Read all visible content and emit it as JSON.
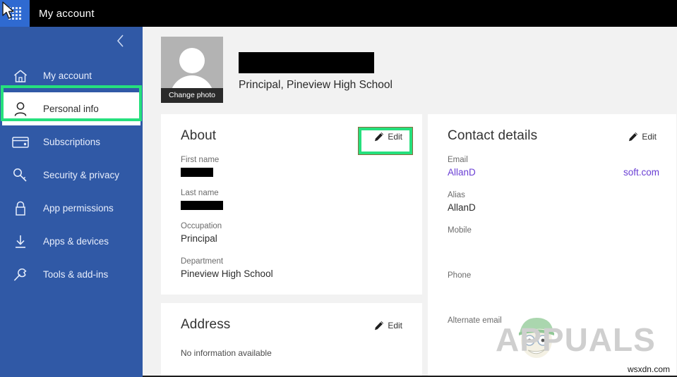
{
  "window": {
    "title": "My account",
    "app_launcher_icon": "waffle-grid-icon",
    "cursor_icon": "mouse-pointer-icon"
  },
  "colors": {
    "sidebar_blue": "#3059a6",
    "launcher_blue": "#2f6ad1",
    "topbar_black": "#000000",
    "page_background": "#f2f2f2",
    "card_white": "#ffffff",
    "highlight_green": "#25e07d",
    "link_purple": "#6a3fd4",
    "label_gray": "#6b6b6b",
    "watermark_gray": "#cfcfcf"
  },
  "sidebar": {
    "collapse_icon": "chevron-left-icon",
    "items": [
      {
        "label": "My account",
        "icon": "home-icon",
        "selected": false
      },
      {
        "label": "Personal info",
        "icon": "person-icon",
        "selected": true
      },
      {
        "label": "Subscriptions",
        "icon": "credit-card-icon",
        "selected": false
      },
      {
        "label": "Security & privacy",
        "icon": "key-icon",
        "selected": false
      },
      {
        "label": "App permissions",
        "icon": "lock-icon",
        "selected": false
      },
      {
        "label": "Apps & devices",
        "icon": "download-icon",
        "selected": false
      },
      {
        "label": "Tools & add-ins",
        "icon": "wrench-icon",
        "selected": false
      }
    ]
  },
  "profile": {
    "photo_caption": "Change photo",
    "avatar_icon": "person-placeholder-icon",
    "name_redacted": true,
    "role": "Principal, Pineview High School"
  },
  "about_card": {
    "title": "About",
    "edit_label": "Edit",
    "edit_icon": "pencil-icon",
    "fields": [
      {
        "label": "First name",
        "value": "",
        "redacted": true
      },
      {
        "label": "Last name",
        "value": "",
        "redacted": true
      },
      {
        "label": "Occupation",
        "value": "Principal",
        "redacted": false
      },
      {
        "label": "Department",
        "value": "Pineview High School",
        "redacted": false
      }
    ]
  },
  "address_card": {
    "title": "Address",
    "edit_label": "Edit",
    "edit_icon": "pencil-icon",
    "empty_text": "No information available"
  },
  "contact_card": {
    "title": "Contact details",
    "edit_label": "Edit",
    "edit_icon": "pencil-icon",
    "email": {
      "label": "Email",
      "value_start": "AllanD",
      "value_end": "soft.com"
    },
    "fields": [
      {
        "label": "Alias",
        "value": "AllanD"
      },
      {
        "label": "Mobile",
        "value": ""
      },
      {
        "label": "Phone",
        "value": ""
      },
      {
        "label": "Alternate email",
        "value": ""
      }
    ]
  },
  "watermark": {
    "text": "APPUALS",
    "mascot_icon": "appuals-mascot-icon"
  },
  "footer": {
    "url": "wsxdn.com"
  }
}
